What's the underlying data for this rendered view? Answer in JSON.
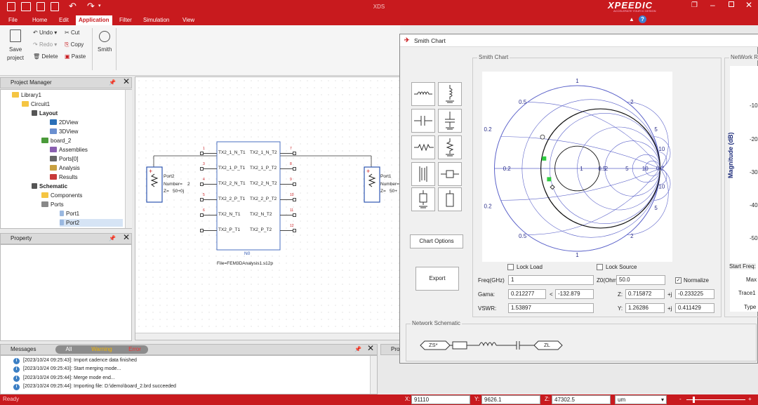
{
  "app": {
    "title": "XDS",
    "brand": "XPEEDIC",
    "brand_sub": "ACCELERATE YOUR IC DESIGN"
  },
  "tabs": [
    "File",
    "Home",
    "Edit",
    "Application",
    "Filter",
    "Simulation",
    "View"
  ],
  "ribbon": {
    "save": "Save",
    "project": "project",
    "undo": "Undo",
    "redo": "Redo",
    "delete": "Delete",
    "cut": "Cut",
    "copy": "Copy",
    "paste": "Paste",
    "smith": "Smith"
  },
  "project_manager": {
    "title": "Project Manager",
    "items": [
      "Library1",
      "Circuit1",
      "Layout",
      "2DView",
      "3DView",
      "board_2",
      "Assemblies",
      "Ports[0]",
      "Analysis",
      "Results",
      "Schematic",
      "Components",
      "Ports",
      "Port1",
      "Port2"
    ]
  },
  "property": {
    "title": "Property"
  },
  "schematic": {
    "port2": {
      "name": "Port2",
      "number": "Number=",
      "num_val": "2",
      "z": "Z=",
      "z_val": "50+0j"
    },
    "port1": {
      "name": "Port1",
      "number": "Number=",
      "z": "Z=",
      "z_val": "50+"
    },
    "block": {
      "name": "N0",
      "file": "File=FEM3DAnalysis1.s12p"
    },
    "pins_left": [
      "TX2_1_N_T1",
      "TX2_1_P_T1",
      "TX2_2_N_T1",
      "TX2_2_P_T1",
      "TX2_N_T1",
      "TX2_P_T1"
    ],
    "pins_right": [
      "TX2_1_N_T2",
      "TX2_1_P_T2",
      "TX2_2_N_T2",
      "TX2_2_P_T2",
      "TX2_N_T2",
      "TX2_P_T2"
    ],
    "pin_nums_left": [
      "1",
      "3",
      "4",
      "5",
      "6"
    ],
    "pin_nums_right": [
      "7",
      "8",
      "9",
      "10",
      "11",
      "12"
    ]
  },
  "messages": {
    "title": "Messages",
    "filter_all": "All",
    "filter_warning": "Warning",
    "filter_error": "Error",
    "lines": [
      "[2023/10/24 09:25:43]: Import cadence data finished",
      "[2023/10/24 09:25:43]: Start merging mode...",
      "[2023/10/24 09:25:44]: Merge mode end...",
      "[2023/10/24 09:25:44]: Importing file: D:\\demo\\board_2.brd succeeded"
    ],
    "side_tab": "Pro"
  },
  "status": {
    "ready": "Ready",
    "x_label": "X:",
    "x": "91110",
    "y_label": "Y:",
    "y": "9626.1",
    "z_label": "Z:",
    "z": "47302.5",
    "unit": "um",
    "zoom_minus": "-",
    "zoom_plus": "+"
  },
  "smith_dialog": {
    "title": "Smith Chart",
    "group_chart": "Smith Chart",
    "group_network": "NetWork Re",
    "group_schematic": "Network Schematic",
    "chart_options": "Chart Options",
    "export": "Export",
    "lock_load": "Lock Load",
    "lock_source": "Lock Source",
    "normalize": "Normalize",
    "freq_label": "Freq(GHz)",
    "freq": "1",
    "z0_label": "Z0(Ohms)",
    "z0": "50.0",
    "gama_label": "Gama:",
    "gama_mag": "0.212277",
    "gama_sep": "<",
    "gama_ang": "-132.879",
    "z_label": "Z:",
    "z_re": "0.715872",
    "z_j": "+j",
    "z_im": "-0.233225",
    "vswr_label": "VSWR:",
    "vswr": "1.53897",
    "y_label": "Y:",
    "y_re": "1.26286",
    "y_j": "+j",
    "y_im": "0.411429",
    "side_labels": [
      "Start Freq:",
      "Max",
      "Trace1",
      "Type"
    ],
    "smith_labels": [
      "1",
      "0.5",
      "2",
      "5",
      "10",
      "0.2",
      "0.2",
      "0.5",
      "1",
      "2",
      "5",
      "10",
      "0.2",
      "0.5",
      "1",
      "2",
      "5",
      "10",
      "0.2"
    ],
    "network_chain": [
      "ZS*",
      "ZL"
    ]
  },
  "chart_data": {
    "type": "line",
    "ylabel": "Magnitude (dB)",
    "yticks": [
      "-10",
      "-20",
      "-30",
      "-40",
      "-50"
    ],
    "ylim": [
      -55,
      0
    ]
  }
}
